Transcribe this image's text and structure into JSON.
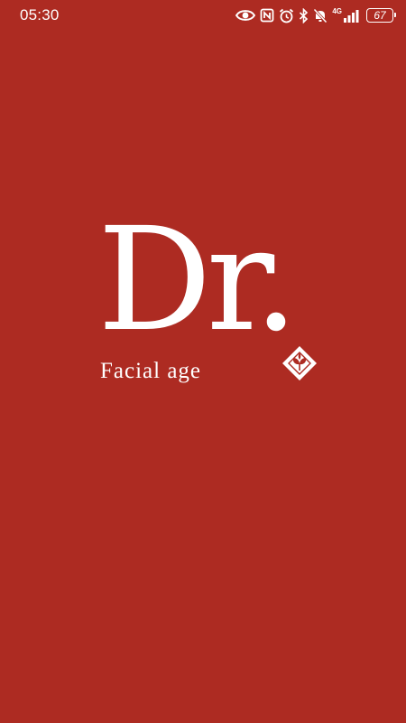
{
  "status_bar": {
    "time": "05:30",
    "network_label": "4G",
    "battery_level": "67",
    "icons": [
      "eye-icon",
      "nfc-icon",
      "alarm-icon",
      "bluetooth-icon",
      "silent-icon",
      "signal-icon",
      "battery-icon"
    ]
  },
  "splash": {
    "logo_main": "Dr.",
    "logo_subtitle": "Facial age",
    "emblem": "leaf-diamond-icon"
  },
  "colors": {
    "background": "#ad2b22",
    "foreground": "#ffffff"
  }
}
